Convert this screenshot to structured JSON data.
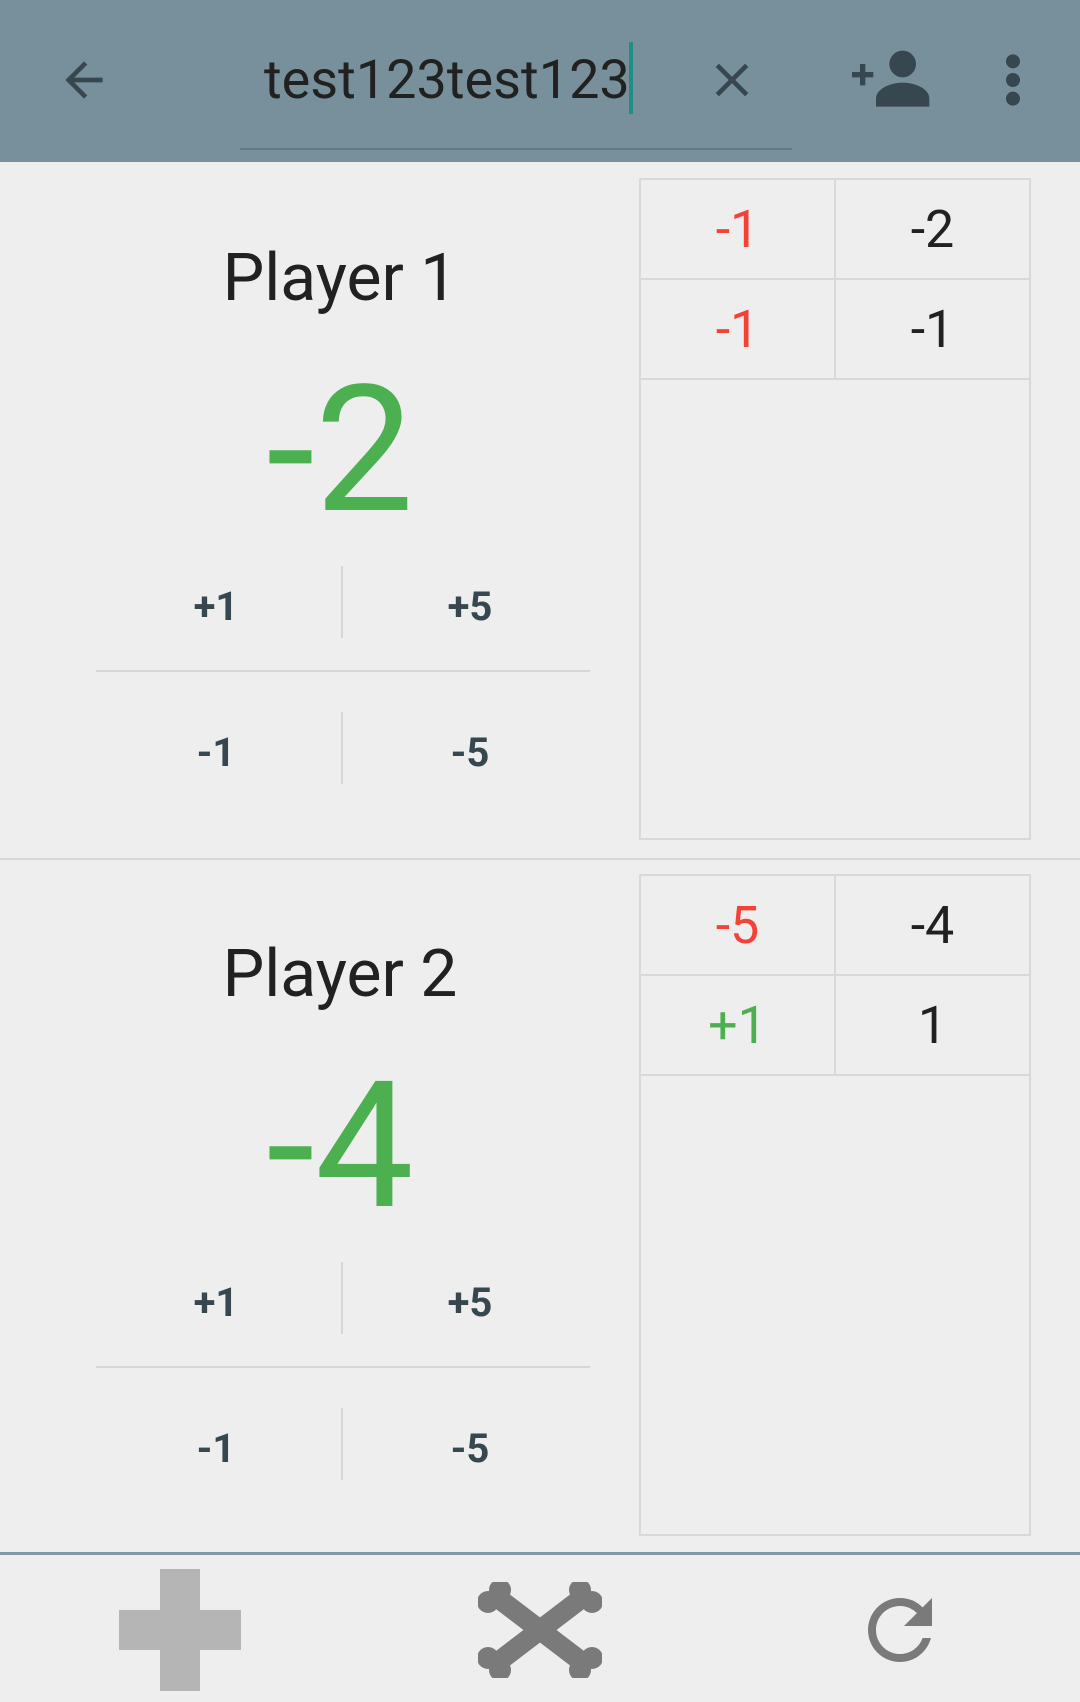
{
  "toolbar": {
    "search_value": "test123test123",
    "icons": [
      "arrow-back-icon",
      "close-icon",
      "person-add-icon",
      "more-vert-icon"
    ]
  },
  "players": [
    {
      "name": "Player 1",
      "score": "-2",
      "buttons": {
        "plus1": "+1",
        "plus5": "+5",
        "minus1": "-1",
        "minus5": "-5"
      },
      "history": [
        {
          "delta": "-1",
          "total": "-2",
          "sign": "negative"
        },
        {
          "delta": "-1",
          "total": "-1",
          "sign": "negative"
        }
      ]
    },
    {
      "name": "Player 2",
      "score": "-4",
      "buttons": {
        "plus1": "+1",
        "plus5": "+5",
        "minus1": "-1",
        "minus5": "-5"
      },
      "history": [
        {
          "delta": "-5",
          "total": "-4",
          "sign": "negative"
        },
        {
          "delta": "+1",
          "total": "1",
          "sign": "positive"
        }
      ]
    }
  ],
  "bottom_bar": {
    "icons": [
      "add-player-icon",
      "crossbones-icon",
      "reset-icon"
    ]
  },
  "colors": {
    "toolbar_bg": "#78909c",
    "score_green": "#4caf50",
    "negative_red": "#f44336",
    "background": "#eeeeee"
  }
}
